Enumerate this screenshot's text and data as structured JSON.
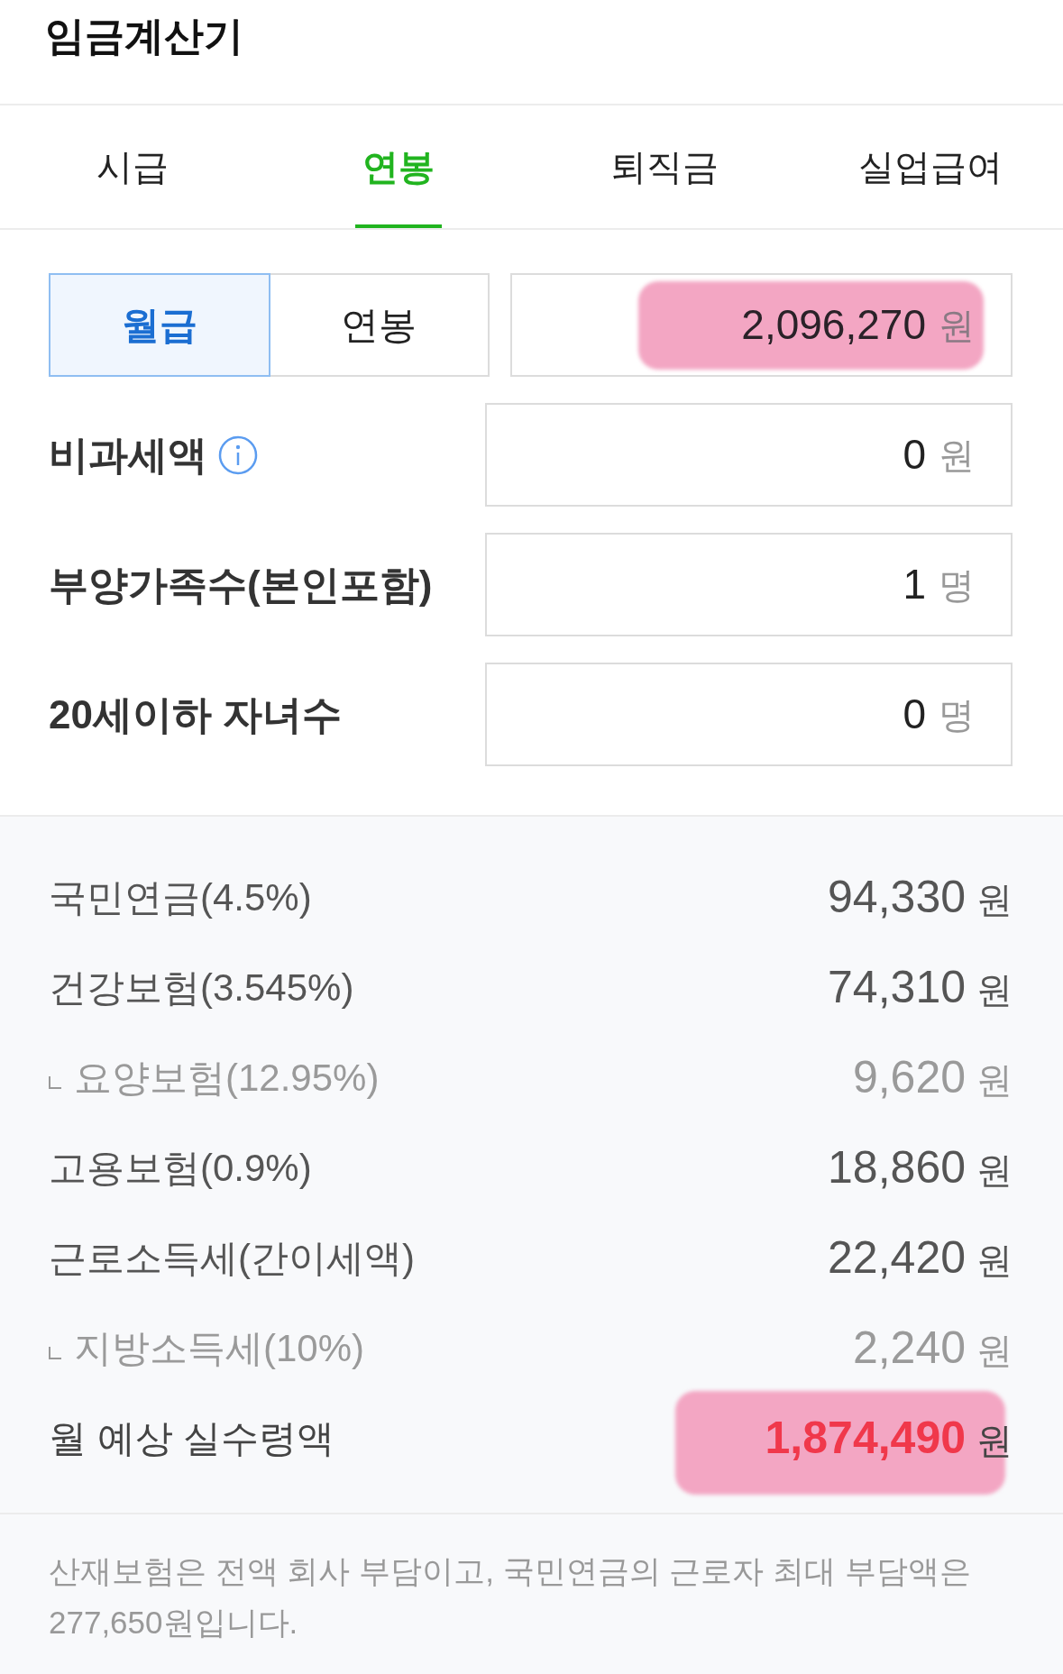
{
  "header": {
    "title": "임금계산기"
  },
  "tabs": [
    {
      "label": "시급",
      "selected": false
    },
    {
      "label": "연봉",
      "selected": true
    },
    {
      "label": "퇴직금",
      "selected": false
    },
    {
      "label": "실업급여",
      "selected": false
    }
  ],
  "pay_type": [
    {
      "label": "월급",
      "selected": true
    },
    {
      "label": "연봉",
      "selected": false
    }
  ],
  "salary": {
    "value": "2,096,270",
    "unit": "원",
    "highlighted": true
  },
  "inputs": [
    {
      "label": "비과세액",
      "info": true,
      "value": "0",
      "unit": "원"
    },
    {
      "label": "부양가족수(본인포함)",
      "info": false,
      "value": "1",
      "unit": "명"
    },
    {
      "label": "20세이하 자녀수",
      "info": false,
      "value": "0",
      "unit": "명"
    }
  ],
  "deductions": [
    {
      "label": "국민연금(4.5%)",
      "value": "94,330",
      "unit": "원"
    },
    {
      "label": "건강보험(3.545%)",
      "value": "74,310",
      "unit": "원",
      "children": [
        {
          "label": "요양보험(12.95%)",
          "value": "9,620",
          "unit": "원"
        }
      ]
    },
    {
      "label": "고용보험(0.9%)",
      "value": "18,860",
      "unit": "원"
    },
    {
      "label": "근로소득세(간이세액)",
      "value": "22,420",
      "unit": "원",
      "children": [
        {
          "label": "지방소득세(10%)",
          "value": "2,240",
          "unit": "원"
        }
      ]
    }
  ],
  "net_pay": {
    "label": "월 예상 실수령액",
    "value": "1,874,490",
    "unit": "원",
    "highlighted": true
  },
  "note": "산재보험은 전액 회사 부담이고, 국민연금의 근로자 최대 부담액은 277,650원입니다."
}
